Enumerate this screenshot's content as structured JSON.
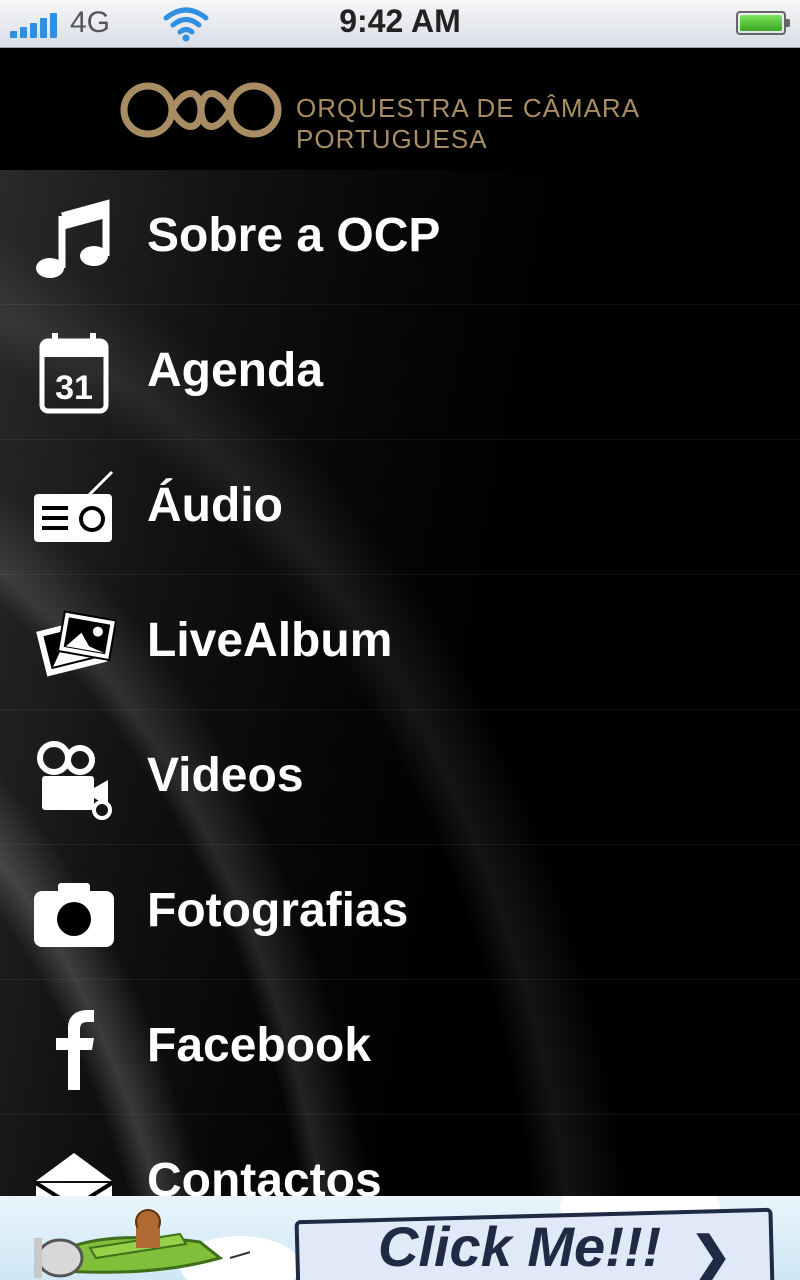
{
  "status_bar": {
    "network": "4G",
    "time": "9:42 AM",
    "icons": [
      "signal-icon",
      "wifi-icon",
      "battery-icon"
    ]
  },
  "header": {
    "logo_text": "ORQUESTRA DE CÂMARA PORTUGUESA",
    "logo_color": "#a88d62"
  },
  "menu": {
    "items": [
      {
        "label": "Sobre a OCP",
        "icon": "music-note-icon"
      },
      {
        "label": "Agenda",
        "icon": "calendar-icon",
        "icon_text": "31"
      },
      {
        "label": "Áudio",
        "icon": "radio-icon"
      },
      {
        "label": "LiveAlbum",
        "icon": "photo-album-icon"
      },
      {
        "label": "Videos",
        "icon": "video-camera-icon"
      },
      {
        "label": "Fotografias",
        "icon": "camera-icon"
      },
      {
        "label": "Facebook",
        "icon": "facebook-icon"
      },
      {
        "label": "Contactos",
        "icon": "envelope-icon"
      }
    ]
  },
  "ad": {
    "text": "Click Me!!!",
    "arrow": "❯"
  }
}
